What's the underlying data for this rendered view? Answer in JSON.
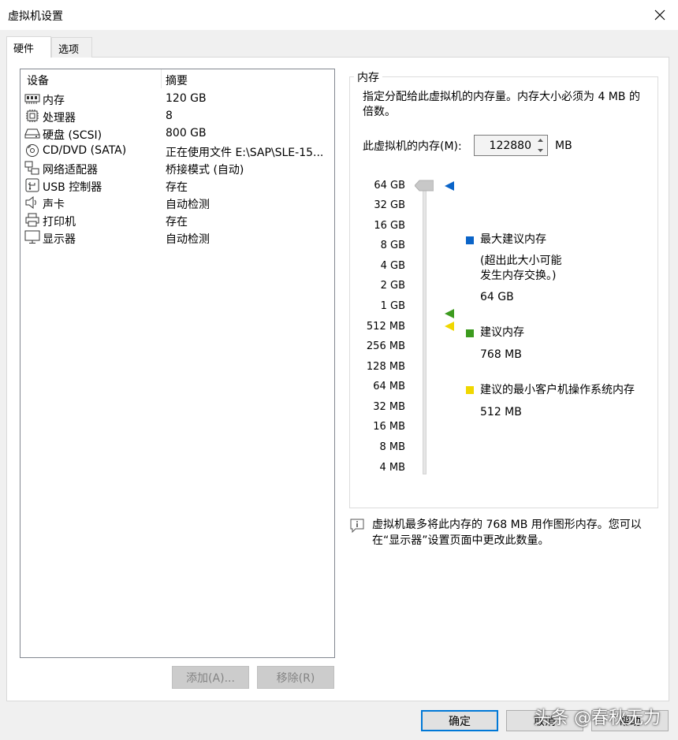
{
  "window": {
    "title": "虚拟机设置"
  },
  "tabs": [
    {
      "label": "硬件"
    },
    {
      "label": "选项"
    }
  ],
  "device_list": {
    "headers": {
      "device": "设备",
      "summary": "摘要"
    },
    "rows": [
      {
        "icon": "memory-icon",
        "name": "内存",
        "summary": "120 GB"
      },
      {
        "icon": "processor-icon",
        "name": "处理器",
        "summary": "8"
      },
      {
        "icon": "hard-disk-icon",
        "name": "硬盘 (SCSI)",
        "summary": "800 GB"
      },
      {
        "icon": "cd-dvd-icon",
        "name": "CD/DVD (SATA)",
        "summary": "正在使用文件 E:\\SAP\\SLE-15..."
      },
      {
        "icon": "network-adapter-icon",
        "name": "网络适配器",
        "summary": "桥接模式 (自动)"
      },
      {
        "icon": "usb-icon",
        "name": "USB 控制器",
        "summary": "存在"
      },
      {
        "icon": "sound-card-icon",
        "name": "声卡",
        "summary": "自动检测"
      },
      {
        "icon": "printer-icon",
        "name": "打印机",
        "summary": "存在"
      },
      {
        "icon": "display-icon",
        "name": "显示器",
        "summary": "自动检测"
      }
    ]
  },
  "buttons": {
    "add": "添加(A)...",
    "remove": "移除(R)",
    "ok": "确定",
    "cancel": "取消",
    "help": "帮助"
  },
  "memory_panel": {
    "group_title": "内存",
    "description": "指定分配给此虚拟机的内存量。内存大小必须为 4 MB 的倍数。",
    "input_label": "此虚拟机的内存(M):",
    "value": "122880",
    "unit": "MB",
    "scale_ticks": [
      "64 GB",
      "32 GB",
      "16 GB",
      "8 GB",
      "4 GB",
      "2 GB",
      "1 GB",
      "512 MB",
      "256 MB",
      "128 MB",
      "64 MB",
      "32 MB",
      "16 MB",
      "8 MB",
      "4 MB"
    ],
    "legend": {
      "max": {
        "label": "最大建议内存",
        "note_line1": "(超出此大小可能",
        "note_line2": "发生内存交换。)",
        "value": "64 GB",
        "color": "#0a64c8"
      },
      "recommended": {
        "label": "建议内存",
        "value": "768 MB",
        "color": "#3c9b1e"
      },
      "min": {
        "label": "建议的最小客户机操作系统内存",
        "value": "512 MB",
        "color": "#f0d700"
      }
    },
    "info_line1": "虚拟机最多将此内存的 768 MB 用作图形内存。您可以",
    "info_line2": "在“显示器”设置页面中更改此数量。"
  },
  "watermark": "头条 @春秋无力"
}
